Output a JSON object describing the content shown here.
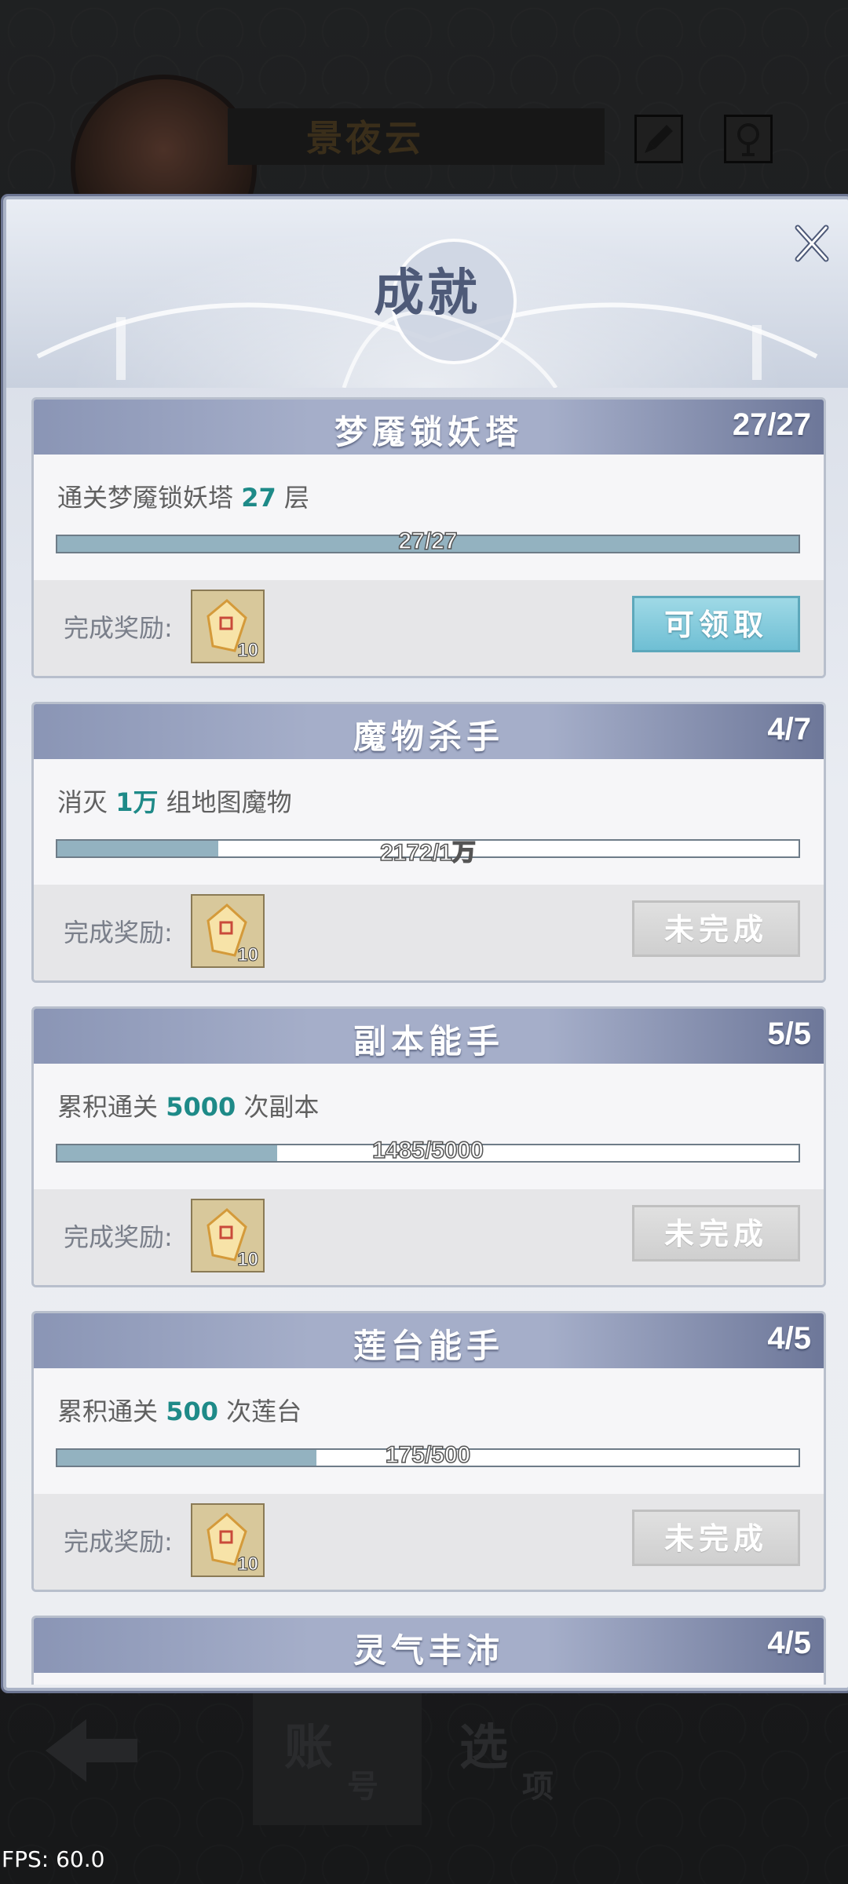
{
  "header": {
    "player_name": "景夜云"
  },
  "modal": {
    "title": "成就"
  },
  "achievements": [
    {
      "title": "梦魇锁妖塔",
      "count": "27/27",
      "desc_pre": "通关梦魇锁妖塔 ",
      "desc_num": "27",
      "desc_post": " 层",
      "progress_text": "27/27",
      "progress": 1.0,
      "reward_label": "完成奖励:",
      "reward_qty": "10",
      "button": "可领取"
    },
    {
      "title": "魔物杀手",
      "count": "4/7",
      "desc_pre": "消灭 ",
      "desc_num": "1万",
      "desc_post": " 组地图魔物",
      "progress_text": "2172/1万",
      "progress": 0.2172,
      "reward_label": "完成奖励:",
      "reward_qty": "10",
      "button": "未完成"
    },
    {
      "title": "副本能手",
      "count": "5/5",
      "desc_pre": "累积通关 ",
      "desc_num": "5000",
      "desc_post": " 次副本",
      "progress_text": "1485/5000",
      "progress": 0.297,
      "reward_label": "完成奖励:",
      "reward_qty": "10",
      "button": "未完成"
    },
    {
      "title": "莲台能手",
      "count": "4/5",
      "desc_pre": "累积通关 ",
      "desc_num": "500",
      "desc_post": " 次莲台",
      "progress_text": "175/500",
      "progress": 0.35,
      "reward_label": "完成奖励:",
      "reward_qty": "10",
      "button": "未完成"
    },
    {
      "title": "灵气丰沛",
      "count": "4/5"
    }
  ],
  "nav": {
    "tab1_big": "账",
    "tab1_small": "号",
    "tab2_big": "选",
    "tab2_small": "项"
  },
  "fps": "FPS: 60.0",
  "colors": {
    "accent_teal": "#1e8a88",
    "header_blue": "#a5aec9",
    "claim": "#6fbfd4"
  }
}
